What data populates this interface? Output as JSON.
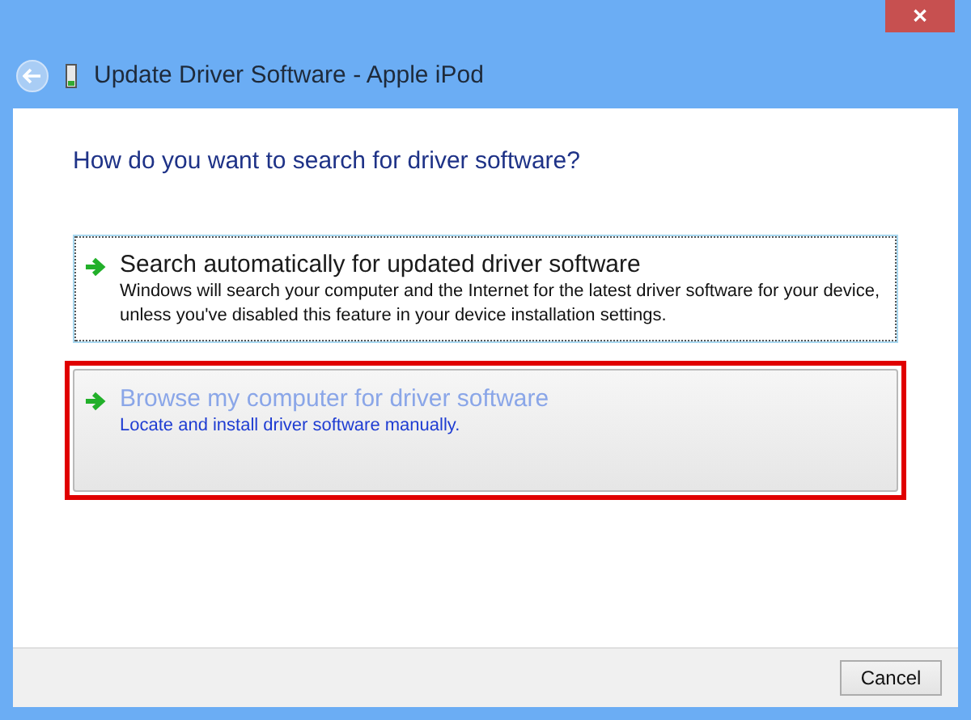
{
  "window": {
    "title": "Update Driver Software - Apple iPod",
    "close": "✕"
  },
  "heading": "How do you want to search for driver software?",
  "options": [
    {
      "title": "Search automatically for updated driver software",
      "description": "Windows will search your computer and the Internet for the latest driver software for your device, unless you've disabled this feature in your device installation settings.",
      "focused": true,
      "hovered": false,
      "highlighted": false
    },
    {
      "title": "Browse my computer for driver software",
      "description": "Locate and install driver software manually.",
      "focused": false,
      "hovered": true,
      "highlighted": true
    }
  ],
  "buttons": [
    "Cancel"
  ]
}
